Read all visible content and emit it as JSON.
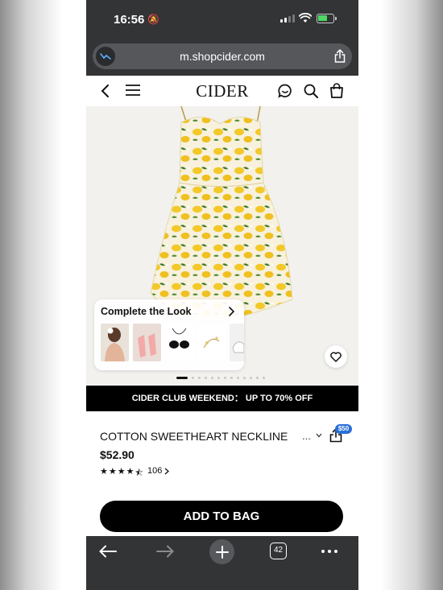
{
  "status_bar": {
    "time": "16:56",
    "battery_charging": true
  },
  "browser": {
    "url": "m.shopcider.com",
    "tab_count": "42"
  },
  "site": {
    "brand": "CIDER"
  },
  "product": {
    "complete_look_title": "Complete the Look",
    "promo": "CIDER CLUB WEEKEND： UP TO 70% OFF",
    "title": "COTTON SWEETHEART NECKLINE",
    "more": "...",
    "coupon": "$50",
    "price": "$52.90",
    "rating_stars": 4.5,
    "review_count": "106",
    "image_count": 13,
    "active_image": 1,
    "cta": "ADD TO BAG"
  },
  "icons": {
    "status": [
      "bell-slash-icon",
      "signal-icon",
      "wifi-icon",
      "battery-icon"
    ],
    "header": [
      "back-icon",
      "menu-icon",
      "chat-icon",
      "search-icon",
      "bag-icon"
    ],
    "toolbar": [
      "back-arrow-icon",
      "forward-arrow-icon",
      "plus-icon",
      "tabs-icon",
      "more-icon"
    ]
  },
  "colors": {
    "accent": "#000000",
    "badge": "#2b6fd6",
    "dress_yellow": "#f3c92a"
  }
}
